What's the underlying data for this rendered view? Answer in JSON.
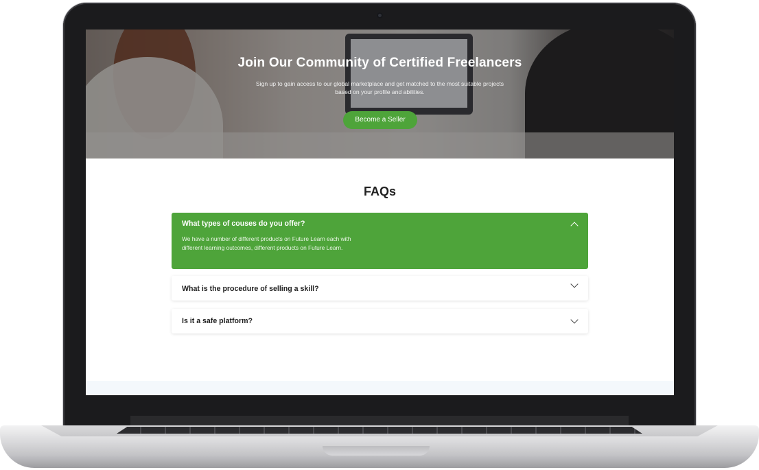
{
  "hero": {
    "title": "Join Our Community of Certified Freelancers",
    "subtitle": "Sign up to gain access to our global marketplace and get matched to the most suitable projects based on your profile and abilities.",
    "cta_label": "Become a Seller"
  },
  "faq": {
    "title": "FAQs",
    "items": [
      {
        "question": "What types of couses do you offer?",
        "answer": "We have a number of different products on Future Learn each with different learning outcomes, different products on Future Learn.",
        "expanded": true
      },
      {
        "question": "What is the procedure of selling a  skill?",
        "answer": "",
        "expanded": false
      },
      {
        "question": "Is it a  safe platform?",
        "answer": "",
        "expanded": false
      }
    ]
  },
  "colors": {
    "accent": "#4ea43a",
    "footer_strip": "#f4f8fc"
  },
  "icons": {
    "expanded": "chevron-up-icon",
    "collapsed": "chevron-down-icon"
  }
}
